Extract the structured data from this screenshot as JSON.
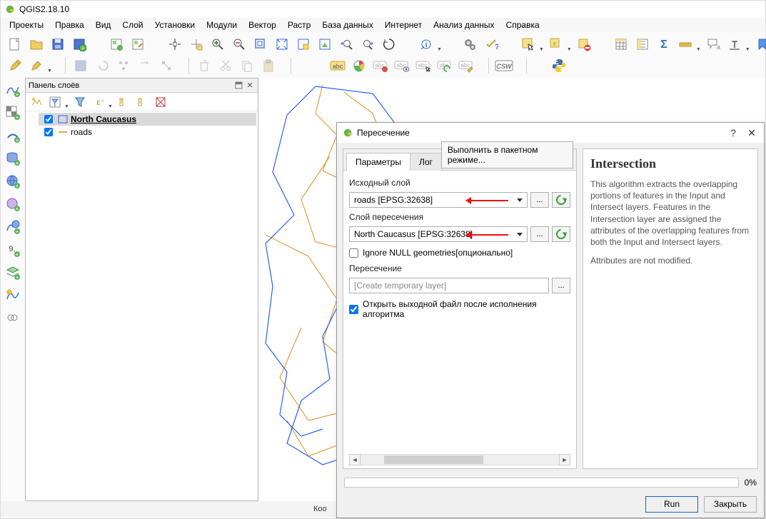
{
  "app": {
    "title": "QGIS2.18.10"
  },
  "menu": [
    "Проекты",
    "Правка",
    "Вид",
    "Слой",
    "Установки",
    "Модули",
    "Вектор",
    "Растр",
    "База данных",
    "Интернет",
    "Анализ данных",
    "Справка"
  ],
  "layers_panel": {
    "title": "Панель слоёв",
    "items": [
      {
        "name": "North Caucasus",
        "checked": true,
        "bold": true,
        "selected": true,
        "color": "#2a60ff",
        "type": "polygon"
      },
      {
        "name": "roads",
        "checked": true,
        "bold": false,
        "selected": false,
        "color": "#e08c1c",
        "type": "line"
      }
    ]
  },
  "statusbar": {
    "coord_label": "Коо"
  },
  "dialog": {
    "title": "Пересечение",
    "tabs": {
      "params": "Параметры",
      "log": "Лог"
    },
    "batch_btn": "Выполнить в пакетном режиме...",
    "form": {
      "input_label": "Исходный слой",
      "input_value": "roads [EPSG:32638]",
      "intersect_label": "Слой пересечения",
      "intersect_value": "North Caucasus [EPSG:32638]",
      "ignore_null": "Ignore NULL geometries[опционально]",
      "ignore_null_checked": false,
      "output_label": "Пересечение",
      "output_placeholder": "[Create temporary layer]",
      "open_after": "Открыть выходной файл после исполнения алгоритма",
      "open_after_checked": true
    },
    "help": {
      "heading": "Intersection",
      "p1": "This algorithm extracts the overlapping portions of features in the Input and Intersect layers. Features in the Intersection layer are assigned the attributes of the overlapping features from both the Input and Intersect layers.",
      "p2": "Attributes are not modified."
    },
    "progress_pct": "0%",
    "run": "Run",
    "close": "Закрыть"
  },
  "icons": {
    "toolbar_row1": [
      "new-project",
      "open-project",
      "save-project",
      "save-project-as",
      "new-composer",
      "composer-manager",
      "",
      "pan",
      "pan-to-selection",
      "zoom-in",
      "zoom-out",
      "zoom-native",
      "zoom-full",
      "zoom-selection",
      "zoom-layer",
      "zoom-last",
      "zoom-next",
      "refresh",
      "",
      "identify",
      "",
      "action",
      "whats-this",
      "",
      "select-feature",
      "select-all",
      "deselect",
      "",
      "sum-stats",
      "measure-line",
      "measure-area",
      "map-tips",
      "text-annotation",
      "bookmarks"
    ],
    "toolbar_row2": [
      "digitize-toggle",
      "digitize-add",
      "",
      "save-layer",
      "rollback",
      "add-feature",
      "select-edit",
      "node-tool",
      "",
      "delete",
      "cut",
      "copy",
      "paste",
      "",
      "label-abc",
      "label-diagram",
      "pin-label",
      "show-hide-label",
      "move-label",
      "rotate-label",
      "change-label",
      "",
      "csw",
      "",
      "",
      "python-console"
    ]
  }
}
